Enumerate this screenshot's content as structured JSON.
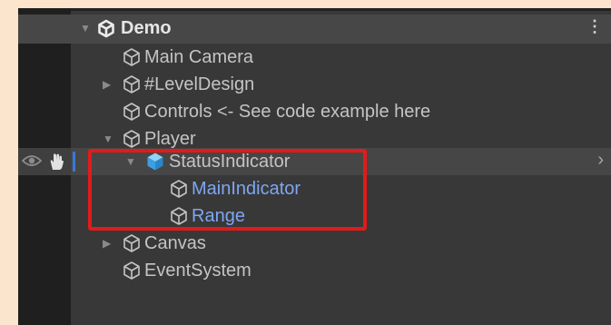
{
  "hierarchy": {
    "scene": {
      "label": "Demo",
      "menu": "⋮"
    },
    "items": [
      {
        "label": "Main Camera"
      },
      {
        "label": "#LevelDesign"
      },
      {
        "label": "Controls <- See code example here"
      },
      {
        "label": "Player"
      },
      {
        "label": "StatusIndicator"
      },
      {
        "label": "MainIndicator"
      },
      {
        "label": "Range"
      },
      {
        "label": "Canvas"
      },
      {
        "label": "EventSystem"
      }
    ]
  },
  "colors": {
    "background": "#fbe5cc",
    "panel": "#383838",
    "child_label": "#7ea6f2",
    "highlight_box": "#e11b1b",
    "prefab_icon": "#4fb6f2"
  },
  "icons": {
    "scene": "unity-logo-icon",
    "gameobject": "cube-outline-icon",
    "prefab": "prefab-cube-icon",
    "visibility": "eye-icon",
    "pickable": "hand-icon"
  }
}
